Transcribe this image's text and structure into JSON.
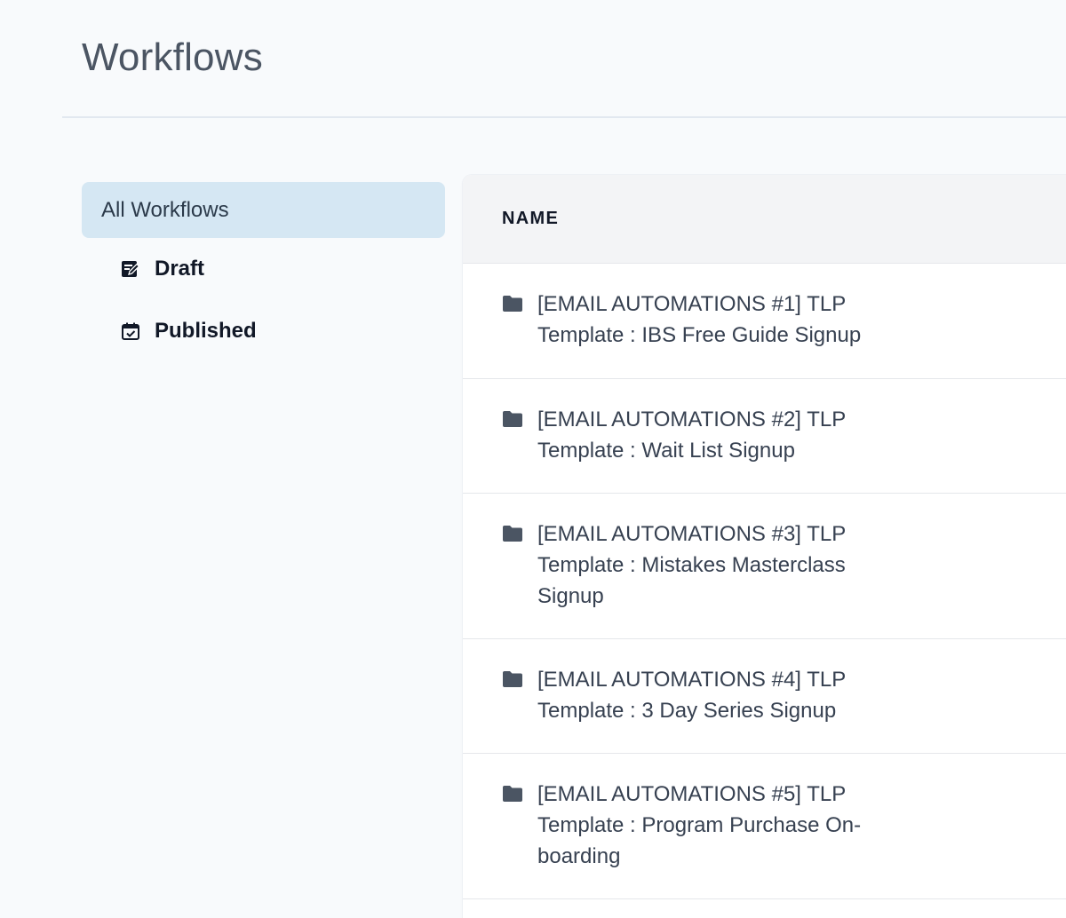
{
  "page": {
    "title": "Workflows"
  },
  "sidebar": {
    "all_label": "All Workflows",
    "draft_label": "Draft",
    "draft_icon": "draft-edit-icon",
    "published_label": "Published",
    "published_icon": "calendar-check-icon"
  },
  "table": {
    "column_name": "NAME",
    "folder_icon": "folder-icon",
    "rows": [
      {
        "name": "[EMAIL AUTOMATIONS #1] TLP Template : IBS Free Guide Signup"
      },
      {
        "name": "[EMAIL AUTOMATIONS #2] TLP Template : Wait List Signup"
      },
      {
        "name": "[EMAIL AUTOMATIONS #3] TLP Template : Mistakes Masterclass Signup"
      },
      {
        "name": "[EMAIL AUTOMATIONS #4] TLP Template : 3 Day Series Signup"
      },
      {
        "name": "[EMAIL AUTOMATIONS #5] TLP Template : Program Purchase On-boarding"
      }
    ]
  },
  "colors": {
    "accent_bg": "#d5e7f3",
    "icon": "#4b5563"
  }
}
